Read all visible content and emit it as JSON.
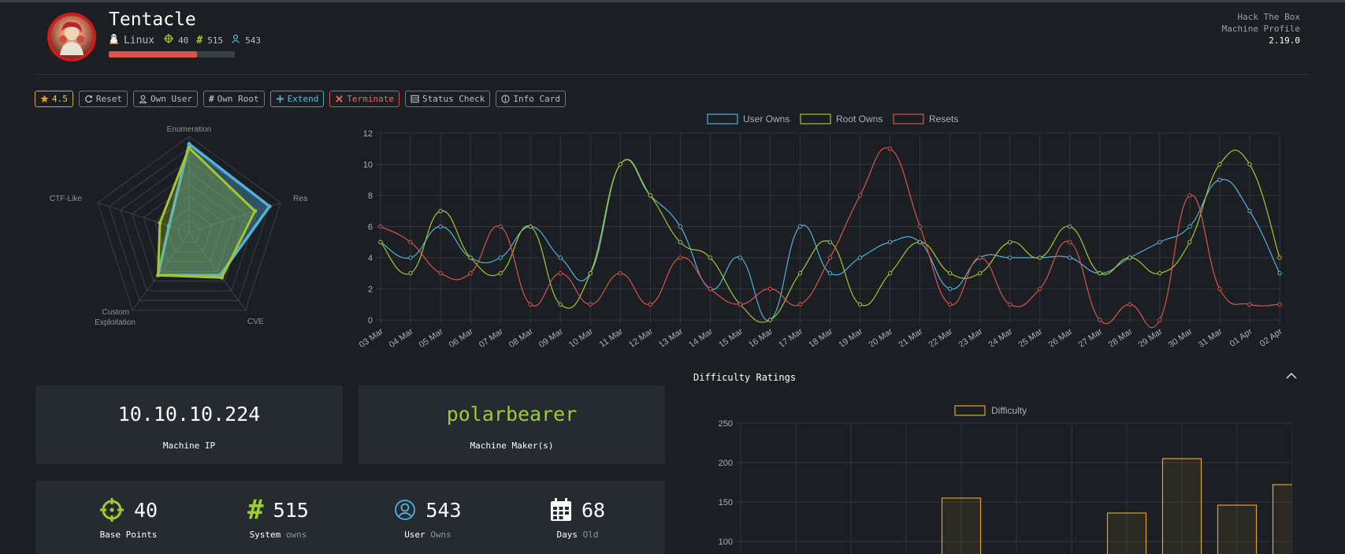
{
  "header": {
    "title": "Tentacle",
    "os": "Linux",
    "points": "40",
    "system_owns": "515",
    "user_owns": "543",
    "progress": 0.7,
    "profile_line1": "Hack The Box",
    "profile_line2": "Machine Profile",
    "version": "2.19.0"
  },
  "toolbar": {
    "rating": "4.5",
    "reset": "Reset",
    "own_user": "Own User",
    "own_root": "Own Root",
    "extend": "Extend",
    "terminate": "Terminate",
    "status_check": "Status Check",
    "info_card": "Info Card"
  },
  "cards": {
    "ip": "10.10.10.224",
    "ip_label": "Machine IP",
    "maker": "polarbearer",
    "maker_label": "Machine Maker(s)"
  },
  "stats": {
    "points": "40",
    "points_label": "Base Points",
    "system": "515",
    "system_label": "System",
    "system_sub": "owns",
    "user": "543",
    "user_label": "User",
    "user_sub": "Owns",
    "days": "68",
    "days_label": "Days",
    "days_sub": "Old"
  },
  "difficulty": {
    "heading": "Difficulty Ratings"
  },
  "colors": {
    "user": "#4fb3d9",
    "root": "#a7c52e",
    "resets": "#d9534f",
    "difficulty": "#e0a128",
    "accent_green": "#9fcc2e"
  },
  "chart_data": [
    {
      "type": "radar",
      "axes": [
        "Enumeration",
        "Real-Life",
        "CVE",
        "Custom Exploitation",
        "CTF-Like"
      ],
      "series": [
        {
          "values": [
            9.2,
            8.8,
            5.5,
            5.5,
            2.2
          ]
        },
        {
          "values": [
            8.8,
            7.2,
            5.8,
            5.5,
            3.2
          ]
        }
      ],
      "rmax": 10
    },
    {
      "type": "line",
      "x": [
        "03 Mar",
        "04 Mar",
        "05 Mar",
        "06 Mar",
        "07 Mar",
        "08 Mar",
        "09 Mar",
        "10 Mar",
        "11 Mar",
        "12 Mar",
        "13 Mar",
        "14 Mar",
        "15 Mar",
        "16 Mar",
        "17 Mar",
        "18 Mar",
        "19 Mar",
        "20 Mar",
        "21 Mar",
        "22 Mar",
        "23 Mar",
        "24 Mar",
        "25 Mar",
        "26 Mar",
        "27 Mar",
        "28 Mar",
        "29 Mar",
        "30 Mar",
        "31 Mar",
        "01 Apr",
        "02 Apr"
      ],
      "series": [
        {
          "name": "User Owns",
          "values": [
            5,
            4,
            6,
            4,
            4,
            6,
            4,
            3,
            10,
            8,
            6,
            2,
            4,
            0,
            6,
            3,
            4,
            5,
            5,
            2,
            4,
            4,
            4,
            4,
            3,
            4,
            5,
            6,
            9,
            7,
            3
          ]
        },
        {
          "name": "Root Owns",
          "values": [
            5,
            3,
            7,
            4,
            3,
            6,
            1,
            3,
            10,
            8,
            5,
            4,
            1,
            0,
            3,
            5,
            1,
            3,
            5,
            3,
            3,
            5,
            4,
            6,
            3,
            4,
            3,
            5,
            10,
            10,
            4
          ]
        },
        {
          "name": "Resets",
          "values": [
            6,
            5,
            3,
            3,
            6,
            1,
            3,
            1,
            3,
            1,
            4,
            2,
            1,
            2,
            1,
            4,
            8,
            11,
            6,
            1,
            4,
            1,
            2,
            5,
            0,
            1,
            0,
            8,
            2,
            1,
            1
          ]
        }
      ],
      "ylim": [
        0,
        12
      ],
      "yticks": [
        0,
        2,
        4,
        6,
        8,
        10,
        12
      ],
      "legend": "top"
    },
    {
      "type": "bar",
      "series": [
        {
          "name": "Difficulty",
          "values": [
            0,
            0,
            0,
            0,
            155,
            0,
            0,
            136,
            205,
            146,
            172
          ]
        }
      ],
      "yticks": [
        100,
        150,
        200,
        250
      ],
      "ylim": [
        100,
        250
      ]
    }
  ]
}
